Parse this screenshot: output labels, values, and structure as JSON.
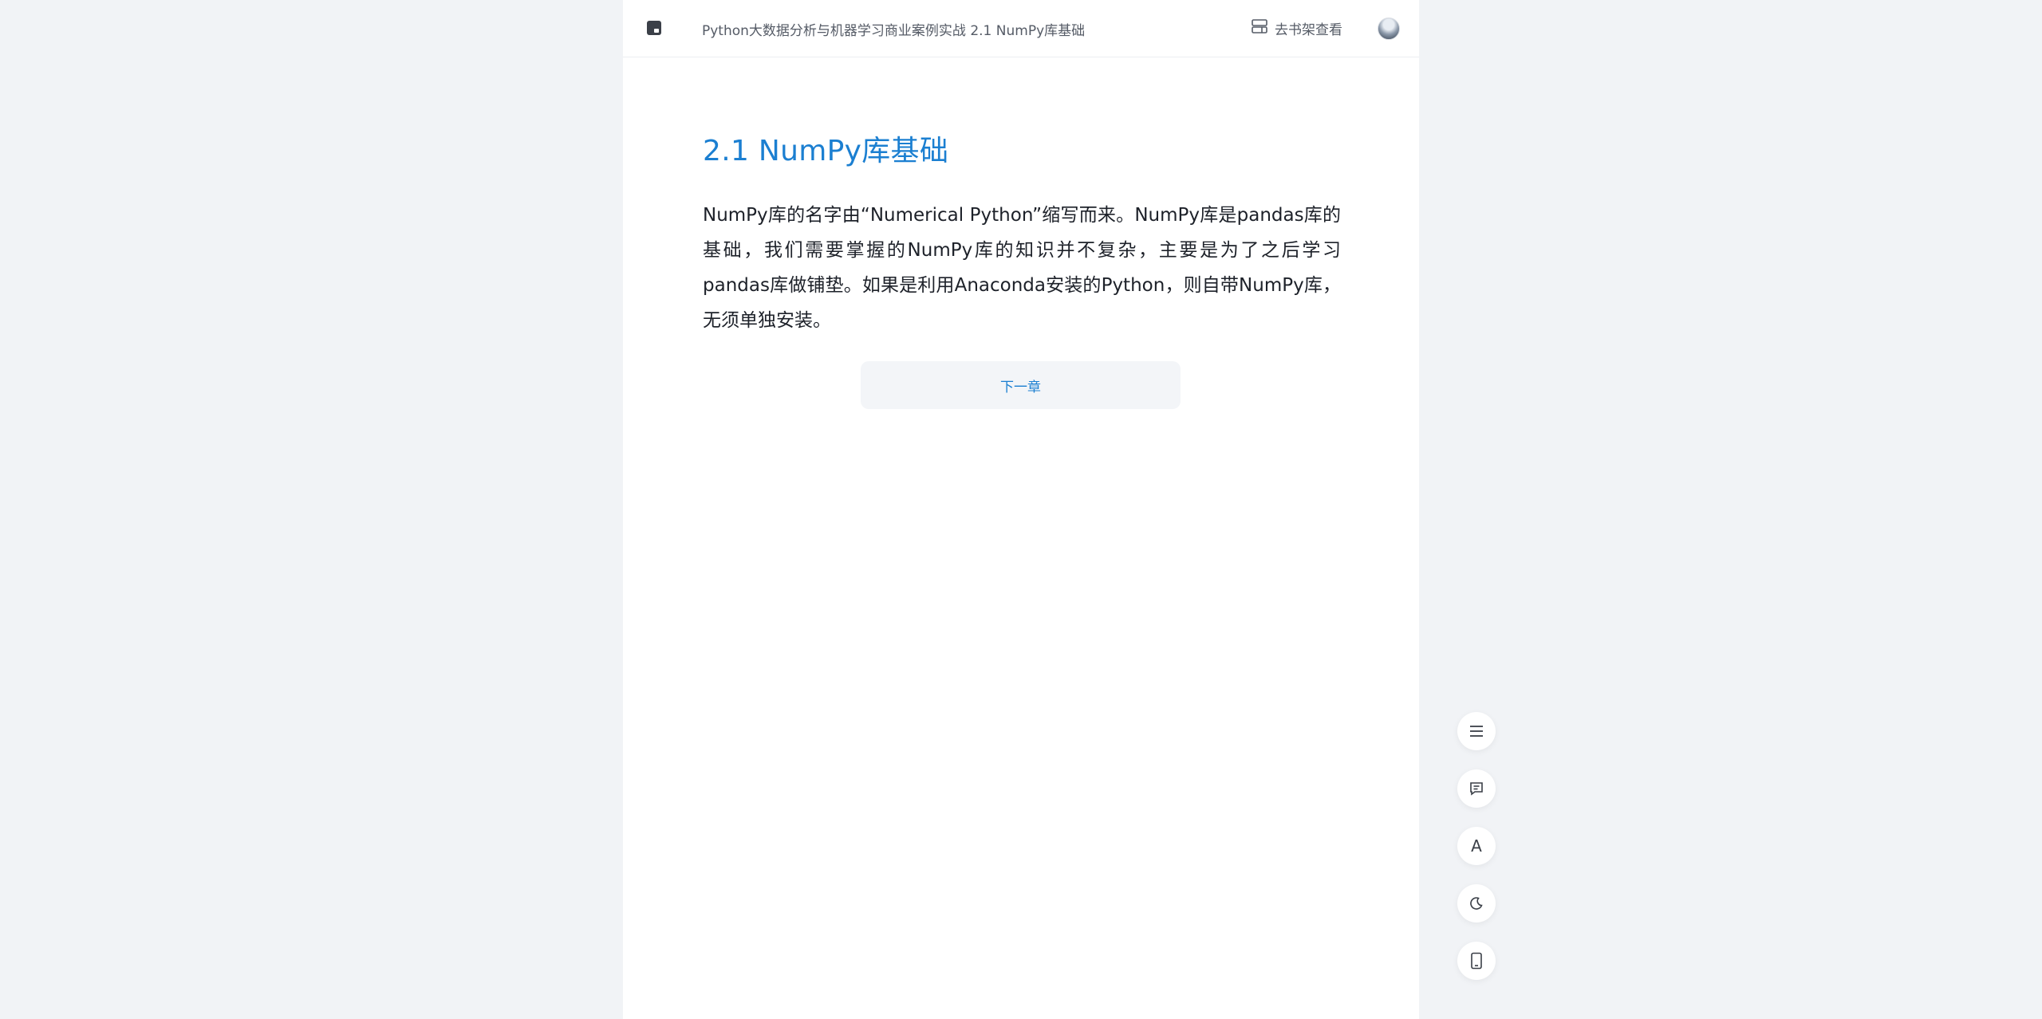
{
  "header": {
    "book_title": "Python大数据分析与机器学习商业案例实战 2.1 NumPy库基础",
    "shelf_label": "去书架查看"
  },
  "chapter": {
    "title": "2.1 NumPy库基础",
    "paragraph": "NumPy库的名字由“Numerical Python”缩写而来。NumPy库是pandas库的基础，我们需要掌握的NumPy库的知识并不复杂，主要是为了之后学习pandas库做铺垫。如果是利用Anaconda安装的Python，则自带NumPy库，无须单独安装。"
  },
  "navigation": {
    "next_chapter_label": "下一章"
  },
  "toolbar": {
    "font_label": "A",
    "items": [
      "menu-icon",
      "comment-icon",
      "font-size-icon",
      "dark-mode-icon",
      "mobile-icon"
    ]
  },
  "colors": {
    "accent": "#1b7fd1",
    "page_bg": "#f1f3f6",
    "reader_bg": "#ffffff"
  }
}
